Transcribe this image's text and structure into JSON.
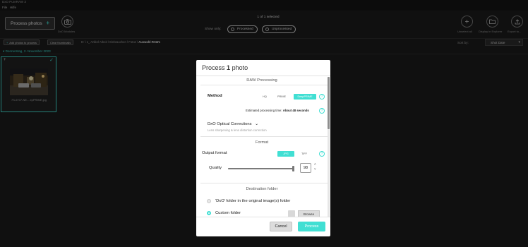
{
  "app": {
    "title": "DxO PureRAW 3"
  },
  "menu": [
    {
      "label": "File"
    },
    {
      "label": "Hilfe"
    }
  ],
  "toolbar": {
    "process_label": "Process photos",
    "process_plus": "+",
    "dxo_modules_label": "DxO Modules",
    "selected_text": "1 of 1 selected",
    "show_only_label": "Show only:",
    "processed_label": "Processed",
    "unprocessed_label": "Unprocessed",
    "right_actions": [
      {
        "label": "Unselect all",
        "icon": "plus-icon"
      },
      {
        "label": "Display in Explorer",
        "icon": "folder-icon"
      },
      {
        "label": "Export to...",
        "icon": "export-icon"
      }
    ]
  },
  "pathbar": {
    "add_photos_label": "Add photos to process",
    "clear_thumbnails_label": "Clear thumbnails",
    "breadcrumb": "D: \\ 1_ Artikel Arbeit \\ Einbrauchen \\ Fotos \\",
    "breadcrumb_current": "Auswahl-RAWs",
    "sort_by_label": "Sort by:",
    "sort_value": "Shot Date"
  },
  "content": {
    "group_header": "Donnerstag, 2. November 2023",
    "thumbnail": {
      "name": "7S-5707-NE....epPRIME.jpg",
      "selected": true
    }
  },
  "dialog": {
    "title_prefix": "Process",
    "title_count": "1",
    "title_suffix": "photo",
    "raw_section": "RAW Processing",
    "method_label": "Method",
    "methods": [
      "HQ",
      "PRIME",
      "DeepPRIME"
    ],
    "active_method": "DeepPRIME",
    "estimated_label": "Estimated processing time:",
    "estimated_value": "About 48 seconds",
    "optical_label": "DxO Optical Corrections",
    "optical_sub": "Lens sharpening & lens distortion correction",
    "format_section": "Format",
    "output_format_label": "Output format",
    "formats": [
      "JPG",
      "TIFF"
    ],
    "active_format": "JPG",
    "quality_label": "Quality",
    "quality_value": "98",
    "quality_level_percent": 98,
    "destination_section": "Destination folder",
    "dest_option1": "'DxO' folder in the original image(s) folder",
    "dest_option2": "Custom folder",
    "dest_selected": "Custom folder",
    "browse_label": "Browse",
    "cancel_label": "Cancel",
    "process_label": "Process",
    "help_glyph": "?"
  },
  "colors": {
    "accent": "#41dfd3",
    "background": "#1c1c1c",
    "dialog_bg": "#ffffff"
  }
}
